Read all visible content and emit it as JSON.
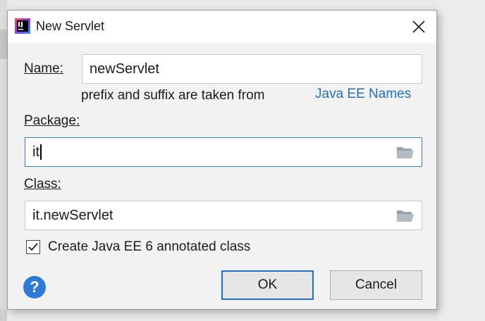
{
  "dialog": {
    "title": "New Servlet",
    "app_icon": "intellij-idea-icon",
    "close_icon": "close-icon"
  },
  "form": {
    "name_label": "Name:",
    "name_value": "newServlet",
    "hint_text": "prefix and suffix are taken from",
    "hint_link": "Java EE Names",
    "package_label": "Package:",
    "package_value": "it",
    "class_label": "Class:",
    "class_value": "it.newServlet",
    "checkbox_label": "Create Java EE 6 annotated class",
    "checkbox_checked": true
  },
  "footer": {
    "help_label": "?",
    "ok_label": "OK",
    "cancel_label": "Cancel"
  },
  "colors": {
    "accent": "#2470c9",
    "link": "#2470b3",
    "help_bg": "#2f7ad6"
  }
}
